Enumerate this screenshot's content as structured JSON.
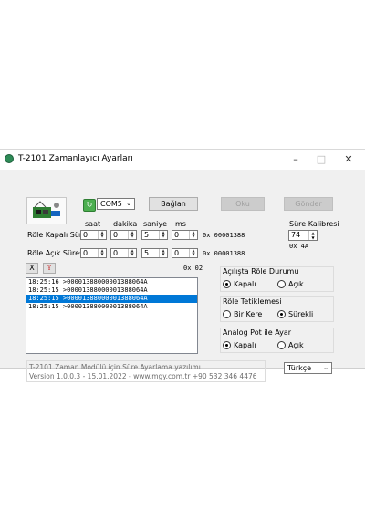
{
  "window": {
    "title": "T-2101 Zamanlayıcı Ayarları",
    "controls": {
      "minimize": "–",
      "maximize": "□",
      "close": "✕"
    }
  },
  "connection": {
    "port": "COM5",
    "connect_label": "Bağlan",
    "read_label": "Oku",
    "send_label": "Gönder"
  },
  "time_columns": [
    "saat",
    "dakika",
    "saniye",
    "ms"
  ],
  "rows": [
    {
      "label": "Röle Kapalı Süresi",
      "values": [
        "0",
        "0",
        "5",
        "0"
      ],
      "hex": "0x 00001388"
    },
    {
      "label": "Röle Açık Süresi --",
      "values": [
        "0",
        "0",
        "5",
        "0"
      ],
      "hex": "0x 00001388"
    }
  ],
  "calibration": {
    "label": "Süre Kalibresi",
    "value": "74",
    "hex": "0x 4A"
  },
  "log": {
    "clear_label": "X",
    "hex": "0x 02",
    "lines": [
      "18:25:16 >00001388000001388064A",
      "18:25:15 >00001388000001388064A",
      "18:25:15 >00001388000001388064A",
      "18:25:15 >00001388000001388064A"
    ],
    "selected_index": 2
  },
  "groups": {
    "startup": {
      "title": "Açılışta Röle Durumu",
      "opt1": "Kapalı",
      "opt2": "Açık",
      "selected": 1
    },
    "trigger": {
      "title": "Röle Tetiklemesi",
      "opt1": "Bir Kere",
      "opt2": "Sürekli",
      "selected": 2
    },
    "analog": {
      "title": "Analog Pot ile Ayar",
      "opt1": "Kapalı",
      "opt2": "Açık",
      "selected": 1
    }
  },
  "info": {
    "line1": "T-2101 Zaman Modülü için Süre Ayarlama yazılımı.",
    "line2": "Version 1.0.0.3 - 15.01.2022 - www.mgy.com.tr +90 532 346 4476"
  },
  "language": "Türkçe",
  "colors": {
    "selection": "#0078d7",
    "window_bg": "#f0f0f0"
  }
}
